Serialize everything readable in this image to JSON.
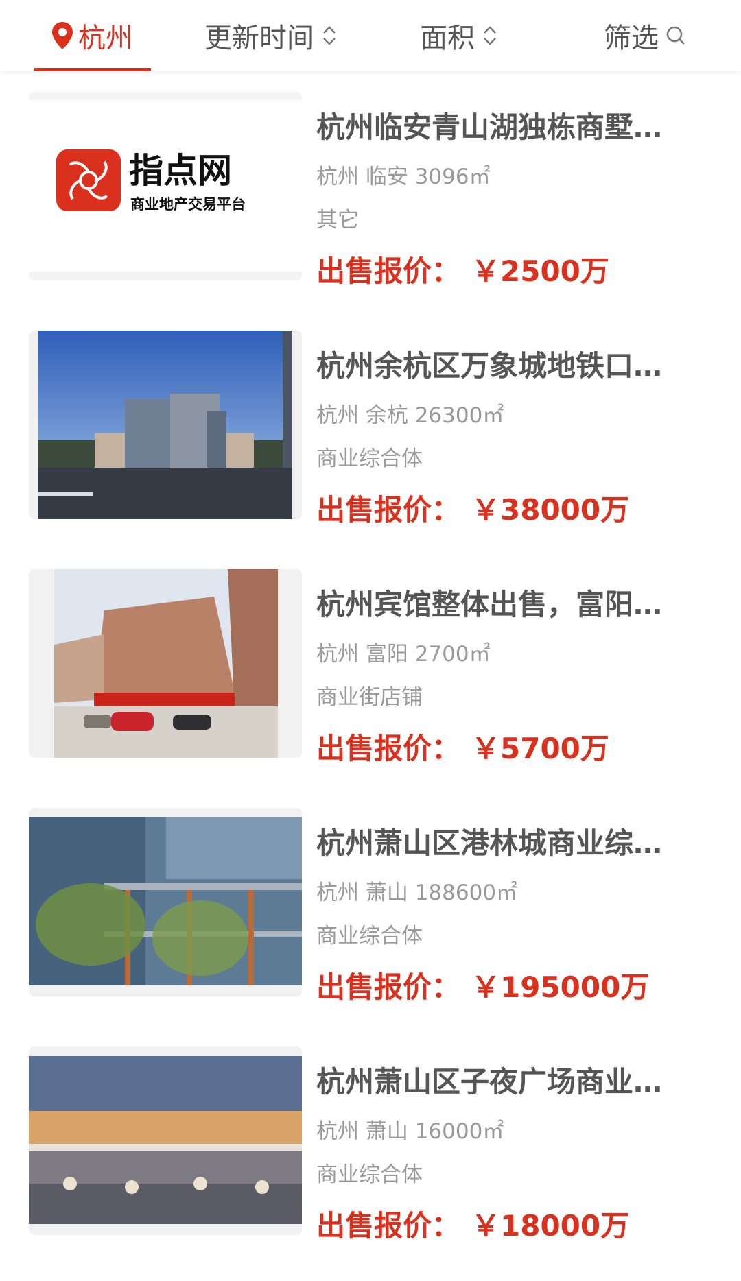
{
  "filter_bar": {
    "city": "杭州",
    "sort_time": "更新时间",
    "sort_area": "面积",
    "filter": "筛选",
    "accent_color": "#d9311e"
  },
  "listings": [
    {
      "title": "杭州临安青山湖独栋商墅…",
      "meta": "杭州 临安 3096㎡",
      "type": "其它",
      "price_label": "出售报价：",
      "price_value": "￥2500万",
      "logo_name": "指点网",
      "logo_tagline": "商业地产交易平台"
    },
    {
      "title": "杭州余杭区万象城地铁口…",
      "meta": "杭州 余杭 26300㎡",
      "type": "商业综合体",
      "price_label": "出售报价：",
      "price_value": "￥38000万"
    },
    {
      "title": "杭州宾馆整体出售，富阳…",
      "meta": "杭州 富阳 2700㎡",
      "type": "商业街店铺",
      "price_label": "出售报价：",
      "price_value": "￥5700万"
    },
    {
      "title": "杭州萧山区港林城商业综…",
      "meta": "杭州 萧山 188600㎡",
      "type": "商业综合体",
      "price_label": "出售报价：",
      "price_value": "￥195000万"
    },
    {
      "title": "杭州萧山区子夜广场商业…",
      "meta": "杭州 萧山 16000㎡",
      "type": "商业综合体",
      "price_label": "出售报价：",
      "price_value": "￥18000万"
    }
  ]
}
